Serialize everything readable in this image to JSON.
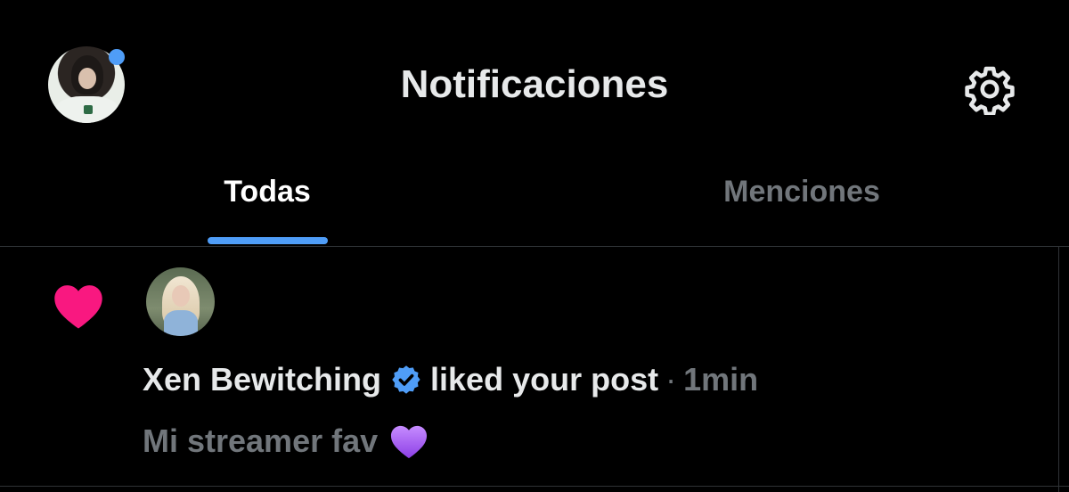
{
  "header": {
    "title": "Notificaciones",
    "has_unread_dot": true,
    "settings_icon": "gear-icon"
  },
  "tabs": [
    {
      "label": "Todas",
      "active": true
    },
    {
      "label": "Menciones",
      "active": false
    }
  ],
  "notifications": [
    {
      "type_icon": "heart-icon",
      "user_name": "Xen Bewitching",
      "verified": true,
      "action": "liked your post",
      "separator": "·",
      "time": "1min",
      "post_text": "Mi streamer fav",
      "post_emoji": "purple-heart-icon"
    }
  ],
  "colors": {
    "background": "#000000",
    "accent": "#4f9df7",
    "like": "#f91880",
    "muted_text": "#71767b",
    "primary_text": "#e7e9ea",
    "emoji_purple": "#a45cf0"
  }
}
